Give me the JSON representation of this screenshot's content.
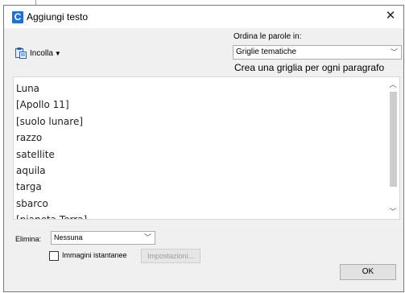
{
  "dialog": {
    "title": "Aggiungi testo",
    "app_icon_letter": "C",
    "close_glyph": "✕"
  },
  "toolbar": {
    "paste_label": "Incolla"
  },
  "ordering": {
    "label": "Ordina le parole in:",
    "selected": "Griglie tematiche",
    "description": "Crea una griglia per ogni paragrafo"
  },
  "words": [
    "Luna",
    "[Apollo 11]",
    "[suolo lunare]",
    "razzo",
    "satellite",
    "aquila",
    "targa",
    "sbarco",
    "[pianeta Terra]"
  ],
  "remove": {
    "label": "Elimina:",
    "selected": "Nessuna"
  },
  "snapshots": {
    "label": "Immagini istantanee",
    "checked": false,
    "settings_label": "Impostazioni..."
  },
  "ok_label": "OK",
  "colors": {
    "app_icon": "#1e6fd9",
    "dialog_bg": "#f0f0f0"
  }
}
